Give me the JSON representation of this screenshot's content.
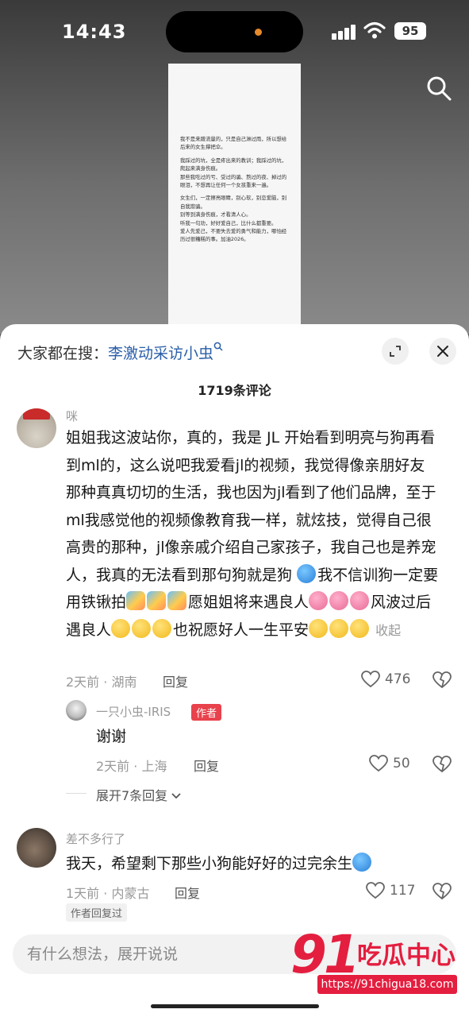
{
  "status_bar": {
    "time": "14:43",
    "battery": "95"
  },
  "document": {
    "paragraphs": [
      "我不是来蹭流量的，只是自己淋过雨，所以想给后来的女生撑把伞。",
      "我踩过的坑，全是疼出来的教训；我踩过的坑，爬起来满身伤痕。\n那些我吃过的亏、受过的骗、熬过的夜、掉过的眼泪，不想再让任何一个女孩重来一遍。",
      "女生们，一定擦亮眼睛，别心软，别恋爱脑，别自我欺骗。\n别等到满身伤痕，才看清人心。\n听我一句劝，好好爱自己，比什么都重要。\n爱人先爱己，不要失去爱的勇气和能力，哪怕经历过很糟糕的事。加油2026。"
    ]
  },
  "search_suggest": {
    "prefix": "大家都在搜：",
    "query": "李激动采访小虫",
    "icon": "search-icon"
  },
  "comment_count": "1719条评论",
  "comments": [
    {
      "user": "咪",
      "text_parts": [
        "姐姐我这波站你，真的，我是 JL 开始看到明亮与狗再看到ml的，这么说吧我爱看jl的视频，我觉得像亲朋好友那种真真切切的生活，我也因为jl看到了他们品牌，至于ml我感觉他的视频像教育我一样，就炫技，觉得自己很高贵的那种，jl像亲戚介绍自己家孩子，我自己也是养宠人，我真的无法看到那句狗就是狗",
        "我不信训狗一定要用铁锹拍",
        "愿姐姐将来遇良人",
        "风波过后遇良人",
        "也祝愿好人一生平安"
      ],
      "collapse": "收起",
      "meta": "2天前 · 湖南",
      "reply": "回复",
      "likes": "476",
      "sub_reply": {
        "user": "一只小虫-IRIS",
        "tag": "作者",
        "text": "谢谢",
        "meta": "2天前 · 上海",
        "reply": "回复",
        "likes": "50"
      },
      "expand": "展开7条回复"
    },
    {
      "user": "差不多行了",
      "text": "我天，希望剩下那些小狗能好好的过完余生",
      "meta": "1天前 · 内蒙古",
      "reply": "回复",
      "likes": "117",
      "author_replied": "作者回复过"
    }
  ],
  "input": {
    "placeholder": "有什么想法，展开说说"
  },
  "watermark": {
    "number": "91",
    "text": "吃瓜中心",
    "url": "https://91chigua18.com"
  },
  "colors": {
    "accent_link": "#2a5ea8",
    "author_tag": "#e8424c",
    "watermark": "#e41e3f"
  }
}
